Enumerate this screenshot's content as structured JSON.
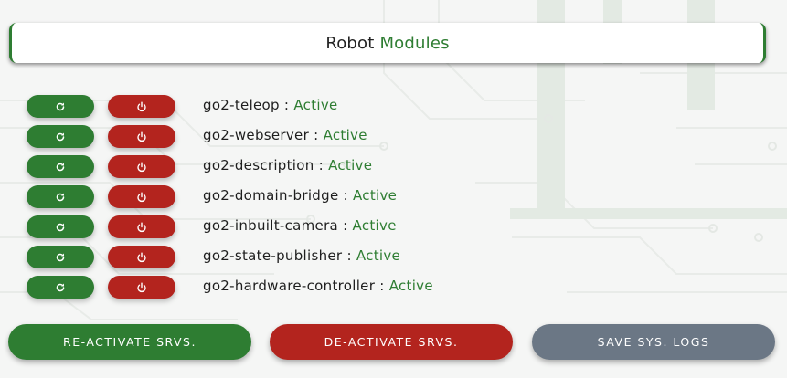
{
  "header": {
    "title_part1": "Robot",
    "title_part2": "Modules"
  },
  "modules": [
    {
      "name": "go2-teleop",
      "status": "Active"
    },
    {
      "name": "go2-webserver",
      "status": "Active"
    },
    {
      "name": "go2-description",
      "status": "Active"
    },
    {
      "name": "go2-domain-bridge",
      "status": "Active"
    },
    {
      "name": "go2-inbuilt-camera",
      "status": "Active"
    },
    {
      "name": "go2-state-publisher",
      "status": "Active"
    },
    {
      "name": "go2-hardware-controller",
      "status": "Active"
    }
  ],
  "separator": " : ",
  "actions": {
    "reactivate_label": "RE-ACTIVATE SRVS.",
    "deactivate_label": "DE-ACTIVATE SRVS.",
    "save_logs_label": "SAVE SYS. LOGS"
  },
  "icons": {
    "restart": "refresh-icon",
    "power": "power-icon"
  },
  "colors": {
    "accent_green": "#2e7d32",
    "danger_red": "#b3241e",
    "neutral_gray": "#6b7785"
  }
}
